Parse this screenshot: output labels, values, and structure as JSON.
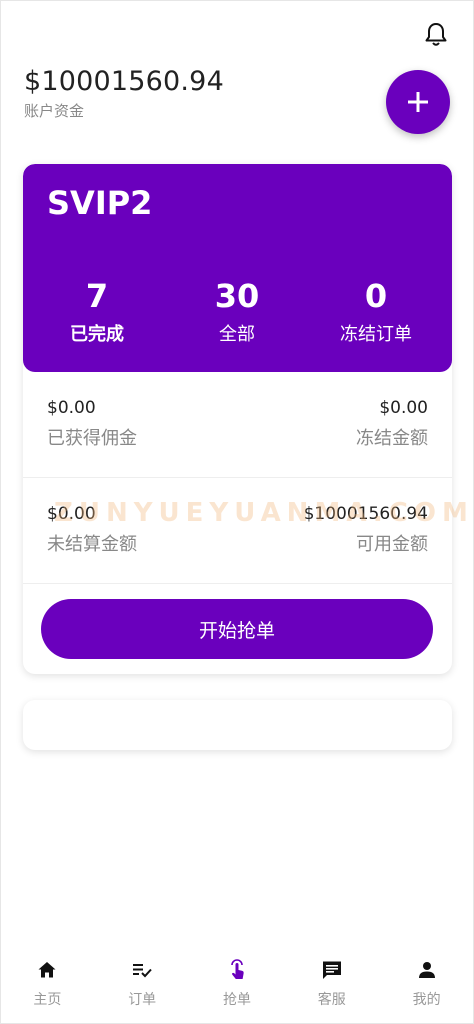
{
  "header": {
    "balance": "$10001560.94",
    "balance_label": "账户资金",
    "bell_icon": "bell-icon",
    "add_icon": "plus-icon"
  },
  "vip": {
    "level": "SVIP2",
    "stats": [
      {
        "value": "7",
        "label": "已完成"
      },
      {
        "value": "30",
        "label": "全部"
      },
      {
        "value": "0",
        "label": "冻结订单"
      }
    ]
  },
  "funds": {
    "earned_commission": {
      "value": "$0.00",
      "label": "已获得佣金"
    },
    "frozen_amount": {
      "value": "$0.00",
      "label": "冻结金额"
    },
    "unsettled_amount": {
      "value": "$0.00",
      "label": "未结算金额"
    },
    "available_amount": {
      "value": "$10001560.94",
      "label": "可用金额"
    }
  },
  "watermark": "ZUNYUEYUANMA.COM",
  "start_button": "开始抢单",
  "tabs": [
    {
      "label": "主页",
      "icon": "home-icon"
    },
    {
      "label": "订单",
      "icon": "order-list-icon"
    },
    {
      "label": "抢单",
      "icon": "tap-icon"
    },
    {
      "label": "客服",
      "icon": "chat-icon"
    },
    {
      "label": "我的",
      "icon": "user-icon"
    }
  ],
  "colors": {
    "accent": "#6a00bd",
    "tab_inactive": "#999999",
    "tab_icon_dark": "#111111"
  }
}
